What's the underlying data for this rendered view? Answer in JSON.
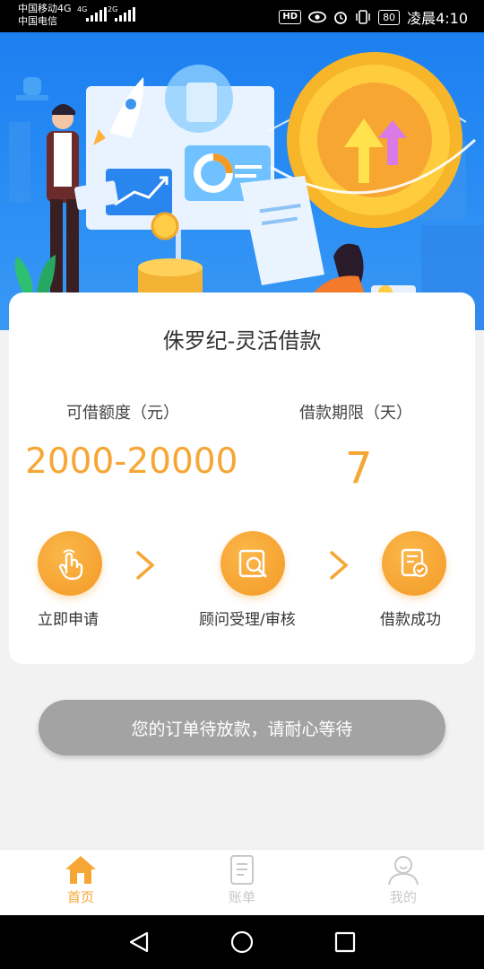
{
  "status_bar": {
    "carrier_1": "中国移动4G",
    "carrier_2": "中国电信",
    "net_1": "4G",
    "net_2": "2G",
    "hd": "HD",
    "battery": "80",
    "time": "凌晨4:10"
  },
  "banner": {
    "icons": [
      "businessman-illustration",
      "rocket-icon",
      "growth-chart-board",
      "gold-coin-icon",
      "woman-illustration",
      "document-icon"
    ]
  },
  "loan_card": {
    "title": "侏罗纪-灵活借款",
    "amount_label": "可借额度（元）",
    "amount_value": "2000-20000",
    "term_label": "借款期限（天）",
    "term_value": "7",
    "steps": [
      {
        "label": "立即申请",
        "icon": "tap-hand-icon"
      },
      {
        "label": "顾问受理/审核",
        "icon": "review-search-icon"
      },
      {
        "label": "借款成功",
        "icon": "approved-document-icon"
      }
    ]
  },
  "order_status": {
    "message": "您的订单待放款，请耐心等待"
  },
  "bottom_nav": {
    "items": [
      {
        "label": "首页",
        "icon": "home-icon",
        "active": true
      },
      {
        "label": "账单",
        "icon": "bill-icon",
        "active": false
      },
      {
        "label": "我的",
        "icon": "profile-icon",
        "active": false
      }
    ]
  },
  "colors": {
    "accent": "#f6a634",
    "banner_blue": "#1c7ff0",
    "inactive": "#c8c8c8",
    "pill_gray": "#a3a3a3"
  }
}
